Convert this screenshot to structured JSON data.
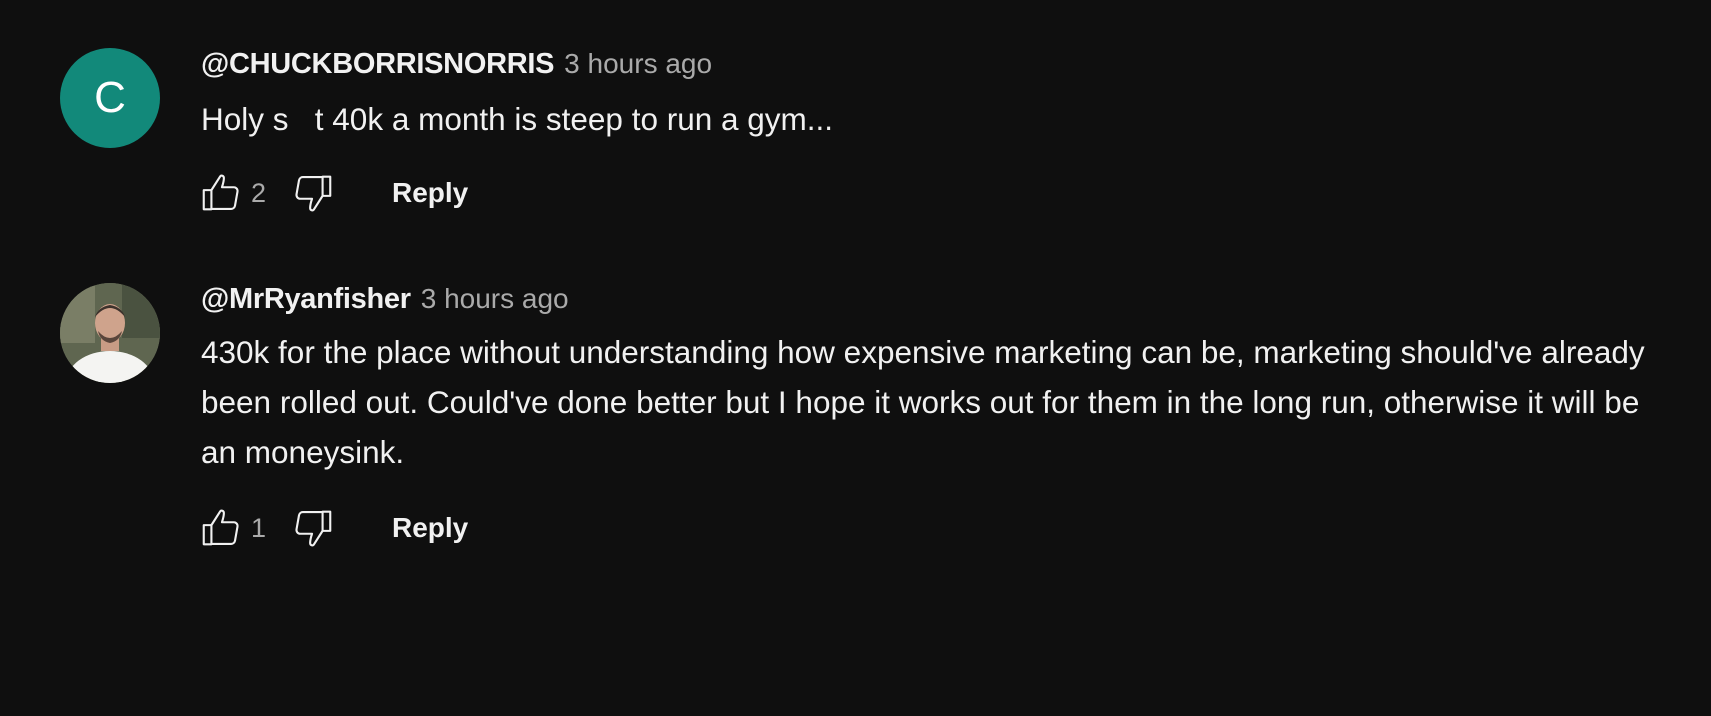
{
  "comments": [
    {
      "author": "@CHUCKBORRISNORRIS",
      "time": "3 hours ago",
      "text": "Holy s   t 40k a month is steep to run a gym...",
      "likes": "2",
      "reply_label": "Reply",
      "avatar_letter": "C",
      "avatar_color": "#12897a"
    },
    {
      "author": "@MrRyanfisher",
      "time": "3 hours ago",
      "text": "430k for the place without understanding how expensive marketing can be, marketing should've already been rolled out. Could've done better but I hope it works out for them in the long run, otherwise it will be an moneysink.",
      "likes": "1",
      "reply_label": "Reply"
    }
  ],
  "icons": {
    "like": "thumbs-up-icon",
    "dislike": "thumbs-down-icon"
  },
  "colors": {
    "background": "#0f0f0f",
    "primary_text": "#f1f1f1",
    "secondary_text": "#aaaaaa"
  }
}
